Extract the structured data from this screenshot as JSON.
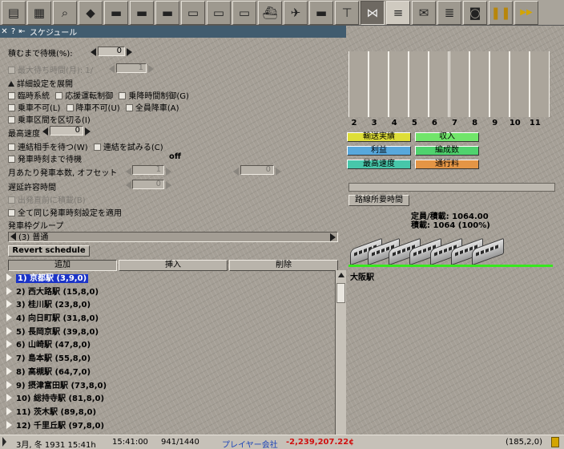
{
  "window": {
    "title": "スケジュール"
  },
  "toolbar_icons": [
    "save-disk-icon",
    "build-map-icon",
    "zoom-magnifier-icon",
    "landscape-tile-icon",
    "rail-vehicles-icon",
    "steam-train-icon",
    "train-icon",
    "monorail-icon",
    "tram-icon",
    "bus-icon",
    "ship-icon",
    "airplane-icon",
    "locomotive-icon",
    "crane-icon",
    "line-management-icon",
    "list-icon",
    "mailbox-icon",
    "finance-stack-icon",
    "screenshot-camera-icon",
    "pause-icon",
    "fast-forward-icon"
  ],
  "form": {
    "load_wait_label": "積むまで待機(%):",
    "load_wait_value": "0",
    "max_wait_label": "最大待ち時間(月): 1/",
    "max_wait_value": "1",
    "advanced_label": "詳細設定を展開",
    "temp_schedule_label": "臨時系統",
    "coupling_label": "応援運転制御",
    "boarding_control_label": "乗降時間制御(G)",
    "no_boarding_label": "乗車不可(L)",
    "no_alighting_label": "降車不可(U)",
    "all_alight_label": "全員降車(A)",
    "split_section_label": "乗車区間を区切る(I)",
    "max_speed_label": "最高速度",
    "max_speed_value": "0",
    "wait_partner_label": "連結相手を待つ(W)",
    "try_couple_label": "連結を試みる(C)",
    "wait_departure_label": "発車時刻まで待機",
    "wait_departure_value": "off",
    "departures_label": "月あたり発車本数, オフセット",
    "departures_value": "1",
    "offset_value": "0",
    "delay_tolerance_label": "遅延許容時間",
    "delay_tolerance_value": "0",
    "load_before_departure_label": "出発直前に積載(B)",
    "apply_same_label": "全て同じ発車時刻設定を適用",
    "group_label": "発車枠グループ",
    "group_selected": "(3) 普通",
    "revert_button": "Revert schedule",
    "add_button": "追加",
    "insert_button": "挿入",
    "delete_button": "削除"
  },
  "schedule": [
    {
      "label": "1) 京都駅 (3,9,0)",
      "selected": true
    },
    {
      "label": "2) 西大路駅 (15,8,0)"
    },
    {
      "label": "3) 桂川駅 (23,8,0)"
    },
    {
      "label": "4) 向日町駅 (31,8,0)"
    },
    {
      "label": "5) 長岡京駅 (39,8,0)"
    },
    {
      "label": "6) 山崎駅 (47,8,0)"
    },
    {
      "label": "7) 島本駅 (55,8,0)"
    },
    {
      "label": "8) 高槻駅 (64,7,0)"
    },
    {
      "label": "9) 摂津富田駅 (73,8,0)"
    },
    {
      "label": "10) 総持寺駅 (81,8,0)"
    },
    {
      "label": "11) 茨木駅 (89,8,0)"
    },
    {
      "label": "12) 千里丘駅 (97,8,0)"
    }
  ],
  "graph": {
    "x_ticks": [
      "2",
      "3",
      "4",
      "5",
      "6",
      "7",
      "8",
      "9",
      "10",
      "11"
    ]
  },
  "legend": [
    {
      "label": "輸送実績",
      "color": "#dede38"
    },
    {
      "label": "収入",
      "color": "#71e56a"
    },
    {
      "label": "利益",
      "color": "#58a8dc"
    },
    {
      "label": "編成数",
      "color": "#4fd36e"
    },
    {
      "label": "最高速度",
      "color": "#47c7aa"
    },
    {
      "label": "通行料",
      "color": "#e49545"
    }
  ],
  "route_time_button": "路線所要時間",
  "capacity_line": "定員/積載: 1064.00",
  "load_line": "積載: 1064 (100%)",
  "convoy_location": "大阪駅",
  "statusbar": {
    "date": "3月, 冬 1931 15:41h",
    "time": "15:41:00",
    "ratio": "941/1440",
    "player": "プレイヤー会社",
    "money": "-2,239,207.22¢",
    "coords": "(185,2,0)",
    "money_color": "#d01010",
    "player_color": "#1c44b8"
  }
}
